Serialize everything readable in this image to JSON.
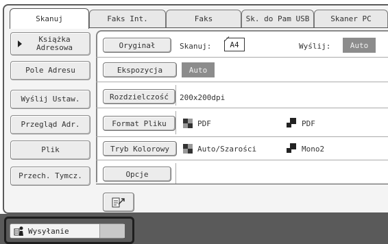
{
  "tabs": [
    {
      "label": "Skanuj",
      "active": true
    },
    {
      "label": "Faks Int.",
      "active": false
    },
    {
      "label": "Faks",
      "active": false
    },
    {
      "label": "Sk. do Pam USB",
      "active": false
    },
    {
      "label": "Skaner PC",
      "active": false
    }
  ],
  "sidebar": {
    "items": [
      {
        "label": "Książka\nAdresowa",
        "icon": "triangle-right-icon"
      },
      {
        "label": "Pole Adresu"
      },
      {
        "label": "Wyślij Ustaw."
      },
      {
        "label": "Przegląd Adr."
      },
      {
        "label": "Plik"
      },
      {
        "label": "Przech. Tymcz."
      }
    ]
  },
  "settings": {
    "original": {
      "button": "Oryginał",
      "scan_label": "Skanuj:",
      "scan_value": "A4",
      "send_label": "Wyślij:",
      "send_value": "Auto"
    },
    "exposure": {
      "button": "Ekspozycja",
      "value": "Auto"
    },
    "resolution": {
      "button": "Rozdzielczość",
      "value": "200x200dpi"
    },
    "file_format": {
      "button": "Format Pliku",
      "color_value": "PDF",
      "mono_value": "PDF"
    },
    "color_mode": {
      "button": "Tryb Kolorowy",
      "color_value": "Auto/Szarości",
      "mono_value": "Mono2"
    },
    "options": {
      "button": "Opcje"
    }
  },
  "preview": {
    "icon": "preview-scan-icon"
  },
  "taskbar": {
    "job_label": "Wysyłanie",
    "icon": "job-status-icon"
  },
  "colors": {
    "badge_gray": "#8c8c8c",
    "bottom_bar": "#5a5a5a",
    "highlight": "#1e1e1e"
  }
}
